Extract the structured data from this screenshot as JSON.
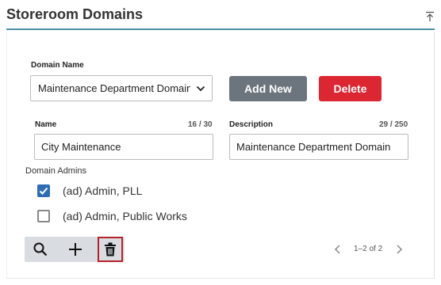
{
  "panel": {
    "title": "Storeroom Domains"
  },
  "domain_select": {
    "label": "Domain Name",
    "value": "Maintenance Department Domain"
  },
  "buttons": {
    "add_new": "Add New",
    "delete": "Delete"
  },
  "name_field": {
    "label": "Name",
    "counter": "16 / 30",
    "value": "City Maintenance"
  },
  "description_field": {
    "label": "Description",
    "counter": "29 / 250",
    "value": "Maintenance Department Domain"
  },
  "admins": {
    "label": "Domain Admins",
    "items": [
      {
        "label": "(ad) Admin, PLL",
        "checked": true
      },
      {
        "label": "(ad) Admin, Public Works",
        "checked": false
      }
    ]
  },
  "pager": {
    "text": "1–2 of 2"
  },
  "colors": {
    "accent_line": "#4a90a4",
    "add_button": "#6c757d",
    "delete_button": "#dc2632",
    "checkbox_checked": "#2e6db4",
    "toolbar_bg": "#d9dce0"
  }
}
